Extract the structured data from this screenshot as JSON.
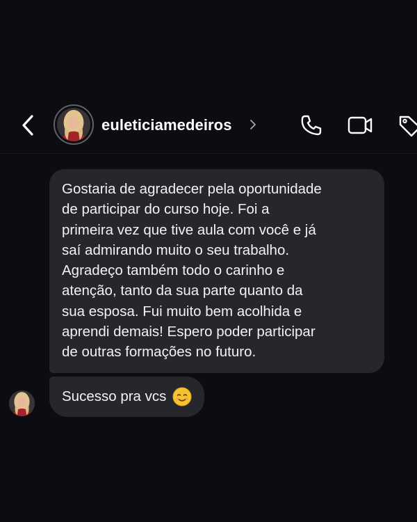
{
  "header": {
    "back_icon": "chevron-left-icon",
    "username": "euleticiamedeiros",
    "profile_chevron_icon": "chevron-right-icon",
    "actions": [
      {
        "name": "voice-call-button",
        "icon": "phone-icon"
      },
      {
        "name": "video-call-button",
        "icon": "video-camera-icon"
      },
      {
        "name": "tag-button",
        "icon": "tag-icon"
      }
    ]
  },
  "messages": [
    {
      "sender": "euleticiamedeiros",
      "text": "Gostaria de agradecer pela oportunidade\nde participar do curso hoje. Foi a\nprimeira vez que tive aula com você e já\nsaí admirando muito o seu trabalho.\nAgradeço também todo o carinho e\natenção, tanto da sua parte quanto da\nsua esposa. Fui muito bem acolhida e\naprendi demais! Espero poder participar\nde outras formações no futuro."
    },
    {
      "sender": "euleticiamedeiros",
      "text": "Sucesso pra vcs",
      "emoji": "smiling-face-icon"
    }
  ],
  "colors": {
    "background": "#0c0d12",
    "bubble": "#26272c",
    "text": "#f2f2f2",
    "emoji": "#f6c22f"
  }
}
